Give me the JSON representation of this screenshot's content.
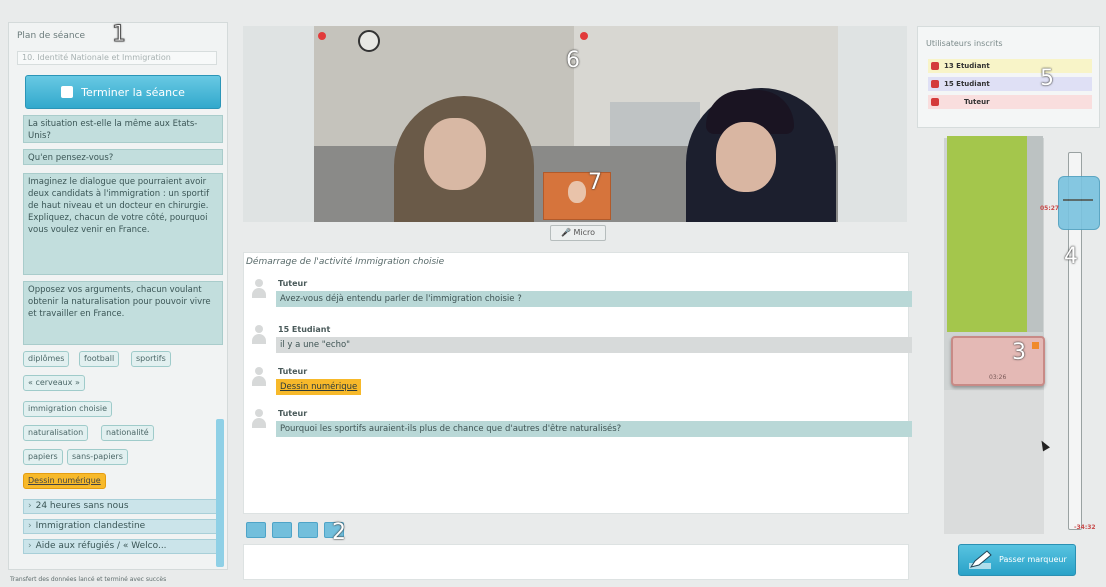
{
  "left_panel": {
    "title": "Plan de séance",
    "plan_input": "10. Identité Nationale et Immigration",
    "end_button": "Terminer la séance",
    "questions": [
      "La situation est-elle la même aux Etats-Unis?",
      "Qu'en pensez-vous?",
      "Imaginez le dialogue que pourraient avoir deux candidats à l'immigration : un sportif de haut niveau et un docteur en chirurgie. Expliquez, chacun de votre côté, pourquoi vous voulez venir en France.",
      "Opposez vos arguments, chacun voulant obtenir la naturalisation pour pouvoir vivre et travailler en France."
    ],
    "tags": [
      "diplômes",
      "football",
      "sportifs",
      "« cerveaux »",
      "immigration choisie",
      "naturalisation",
      "nationalité",
      "papiers",
      "sans-papiers"
    ],
    "highlight_tag": "Dessin numérique",
    "activities": [
      "24 heures sans nous",
      "Immigration clandestine",
      "Aide aux réfugiés / « Welco..."
    ],
    "status_text": "Transfert des données lancé et terminé avec succès"
  },
  "video": {
    "micro_label": "Micro"
  },
  "chat": {
    "header": "Démarrage de l'activité Immigration choisie",
    "messages": [
      {
        "author": "Tuteur",
        "text": "Avez-vous déjà entendu parler de l'immigration choisie ?",
        "style": "teal"
      },
      {
        "author": "15 Etudiant",
        "text": "il y a une \"echo\"",
        "style": "grey"
      },
      {
        "author": "Tuteur",
        "text": "Dessin numérique",
        "style": "link"
      },
      {
        "author": "Tuteur",
        "text": "Pourquoi les sportifs auraient-ils plus de chance que d'autres d'être naturalisés?",
        "style": "teal"
      }
    ]
  },
  "users_panel": {
    "title": "Utilisateurs inscrits",
    "users": [
      {
        "name": "13 Etudiant",
        "color": "#f8f4c8"
      },
      {
        "name": "15 Etudiant",
        "color": "#dfe0f5"
      },
      {
        "name": "Tuteur",
        "color": "#f9dede"
      }
    ]
  },
  "timeline": {
    "handle_time": "05:27",
    "block_time": "03:26",
    "end_time": "-34:32"
  },
  "pass_button": "Passer marqueur",
  "annotations": [
    "1",
    "2",
    "3",
    "4",
    "5",
    "6",
    "7"
  ]
}
